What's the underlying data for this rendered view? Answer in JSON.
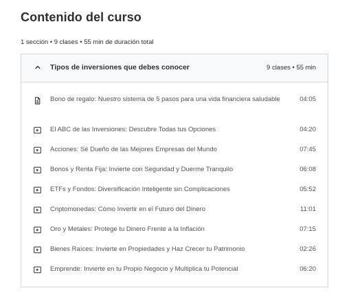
{
  "page": {
    "title": "Contenido del curso",
    "summary": "1 sección • 9 clases • 55 min de duración total"
  },
  "section": {
    "title": "Tipos de inversiones que debes conocer",
    "meta": "9 clases • 55 min",
    "expanded": true,
    "toggle_icon": "chevron-up-icon"
  },
  "lessons": [
    {
      "title": "Bono de regalo: Nuestro sistema de 5 pasos para una vida financiera saludable",
      "duration": "04:05",
      "icon": "document-icon"
    },
    {
      "title": "El ABC de las Inversiones: Descubre Todas tus Opciones",
      "duration": "04:20",
      "icon": "video-icon"
    },
    {
      "title": "Acciones: Sé Dueño de las Mejores Empresas del Mundo",
      "duration": "07:45",
      "icon": "video-icon"
    },
    {
      "title": "Bonos y Renta Fija: Invierte con Seguridad y Duerme Tranquilo",
      "duration": "06:08",
      "icon": "video-icon"
    },
    {
      "title": "ETFs y Fondos: Diversificación Inteligente sin Complicaciones",
      "duration": "05:52",
      "icon": "video-icon"
    },
    {
      "title": "Criptomonedas: Cómo Invertir en el Futuro del Dinero",
      "duration": "11:01",
      "icon": "video-icon"
    },
    {
      "title": "Oro y Metales: Protege tu Dinero Frente a la Inflación",
      "duration": "07:15",
      "icon": "video-icon"
    },
    {
      "title": "Bienes Raíces: Invierte en Propiedades y Haz Crecer tu Patrimonio",
      "duration": "02:26",
      "icon": "video-icon"
    },
    {
      "title": "Emprende: Invierte en tu Propio Negocio y Multiplica tu Potencial",
      "duration": "06:20",
      "icon": "video-icon"
    }
  ]
}
